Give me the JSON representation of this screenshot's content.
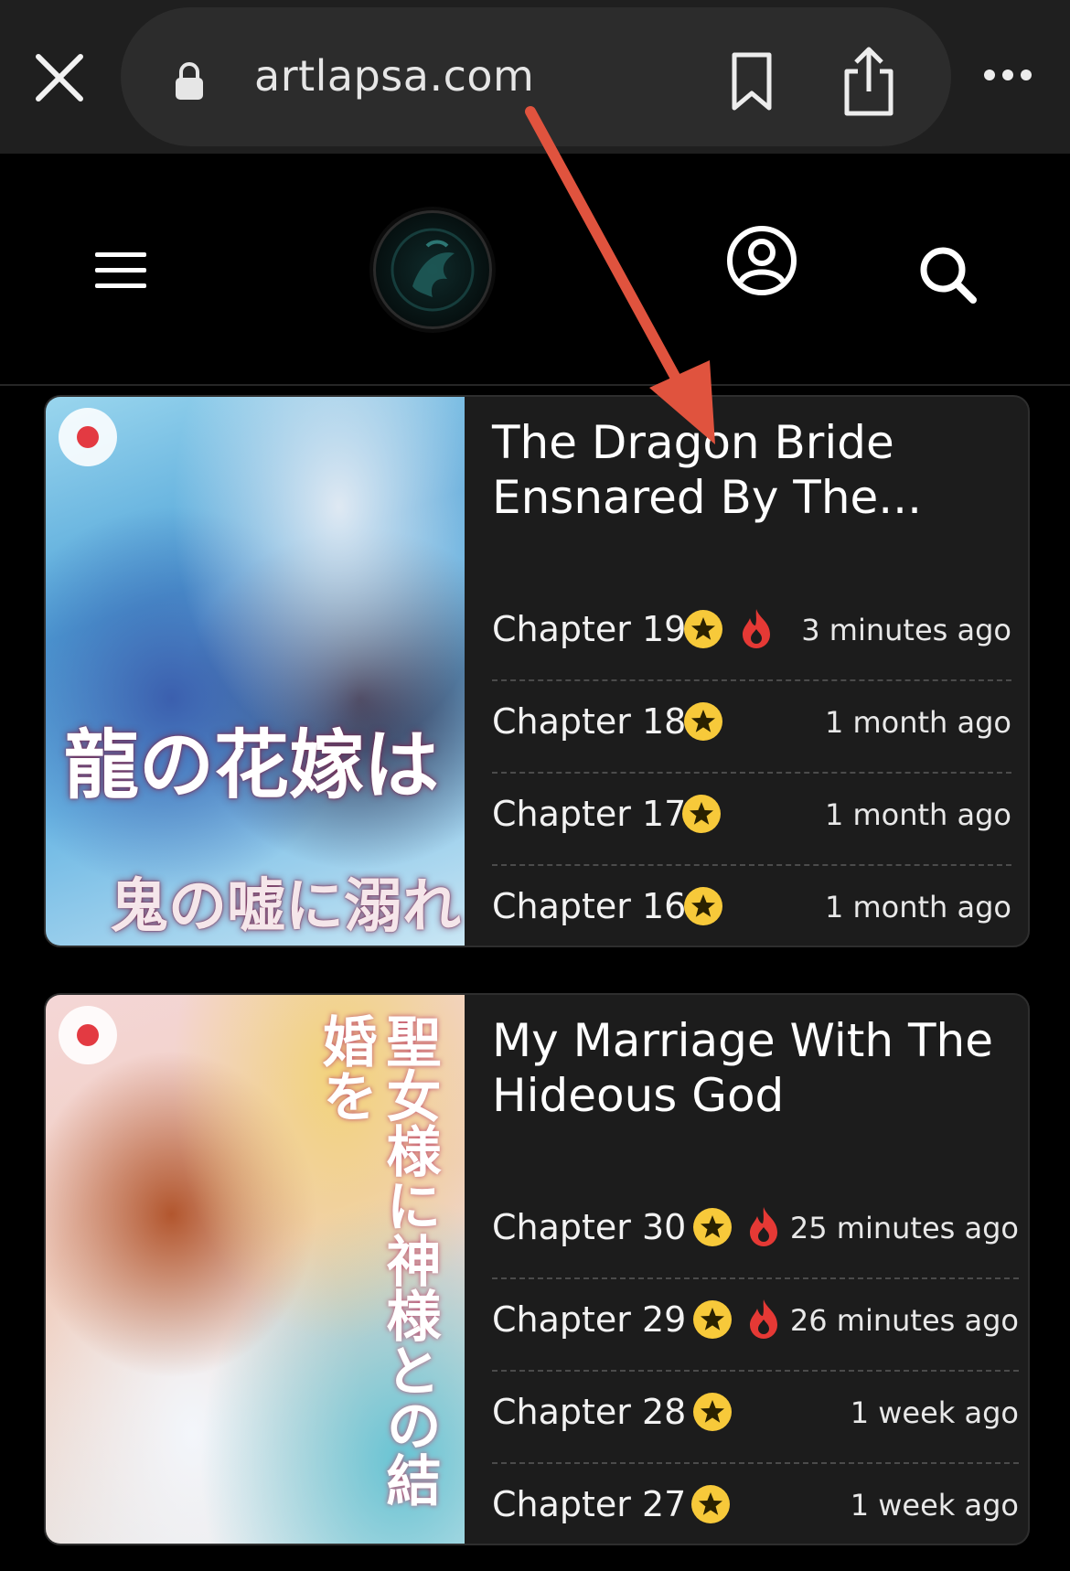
{
  "browser": {
    "url": "artlapsa.com",
    "icons": {
      "close": "close-icon",
      "lock": "lock-icon",
      "bookmark": "bookmark-icon",
      "share": "share-icon",
      "more": "more-icon"
    }
  },
  "header": {
    "icons": {
      "menu": "hamburger-menu-icon",
      "logo": "site-logo",
      "account": "account-icon",
      "search": "search-icon"
    }
  },
  "colors": {
    "badge_star": "#f7c93a",
    "fire": "#e53935",
    "annotation_arrow": "#e0533e",
    "hot_dot": "#e33a42"
  },
  "series": [
    {
      "title": "The Dragon Bride Ensnared By The...",
      "cover_text": "龍の花嫁は",
      "cover_subtext": "鬼の嘘に溺れる",
      "chapters": [
        {
          "label": "Chapter 19",
          "time": "3 minutes ago",
          "hot": true
        },
        {
          "label": "Chapter 18",
          "time": "1 month ago",
          "hot": false
        },
        {
          "label": "Chapter 17",
          "time": "1 month ago",
          "hot": false
        },
        {
          "label": "Chapter 16",
          "time": "1 month ago",
          "hot": false
        }
      ]
    },
    {
      "title": "My Marriage With The Hideous God",
      "cover_text": "聖女様に神様との結婚を",
      "chapters": [
        {
          "label": "Chapter 30",
          "time": "25 minutes ago",
          "hot": true
        },
        {
          "label": "Chapter 29",
          "time": "26 minutes ago",
          "hot": true
        },
        {
          "label": "Chapter 28",
          "time": "1 week ago",
          "hot": false
        },
        {
          "label": "Chapter 27",
          "time": "1 week ago",
          "hot": false
        }
      ]
    }
  ]
}
